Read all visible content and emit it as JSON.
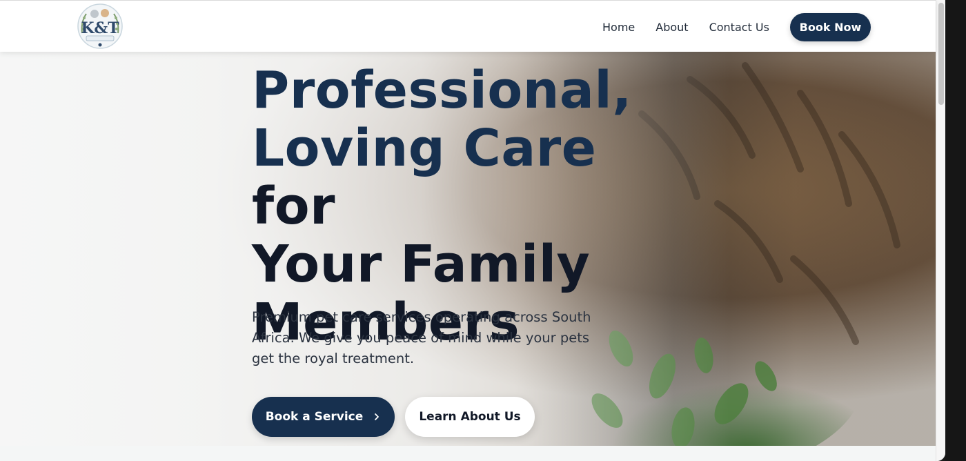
{
  "header": {
    "logo": "K&T Pet Services logo",
    "nav": {
      "home": "Home",
      "about": "About",
      "contact": "Contact Us",
      "book_now": "Book Now"
    }
  },
  "hero": {
    "title_line1": "Professional,",
    "title_line2_accent": "Loving Care",
    "title_line2_rest": " for",
    "title_line3": "Your Family",
    "title_line4": "Members",
    "subtitle": "Premium pet care services operating across South Africa. We give you peace of mind while your pets get the royal treatment.",
    "primary_button": "Book a Service",
    "secondary_button": "Learn About Us",
    "background": "cat-in-plants-photo"
  },
  "colors": {
    "brand_navy": "#17304f",
    "text_dark": "#111827",
    "header_bg": "#ffffff"
  }
}
